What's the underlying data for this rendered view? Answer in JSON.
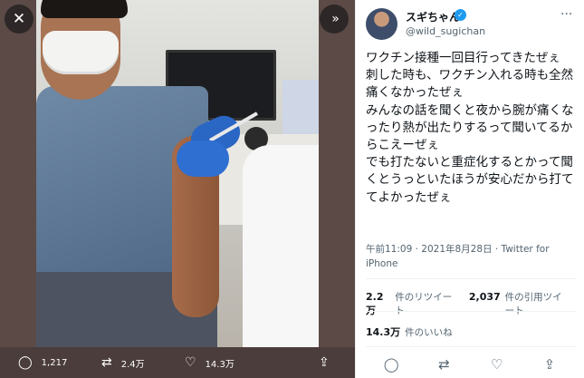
{
  "viewer": {
    "close_icon": "close-icon",
    "expand_icon": "expand-icon",
    "close_glyph": "✕",
    "expand_glyph": "»"
  },
  "media_actions": {
    "replies": "1,217",
    "retweets": "2.4万",
    "likes": "14.3万"
  },
  "tweet": {
    "display_name": "スギちゃん",
    "handle": "@wild_sugichan",
    "text": "ワクチン接種一回目行ってきたぜぇ\n刺した時も、ワクチン入れる時も全然痛くなかったぜぇ\nみんなの話を聞くと夜から腕が痛くなったり熱が出たりするって聞いてるからこえーぜぇ\nでも打たないと重症化するとかって聞くとうっといたほうが安心だから打ててよかったぜぇ",
    "timestamp": "午前11:09 · 2021年8月28日 · Twitter for iPhone",
    "retweet_count": "2.2万",
    "retweet_label": "件のリツイート",
    "quote_count": "2,037",
    "quote_label": "件の引用ツイート",
    "like_count": "14.3万",
    "like_label": "件のいいね"
  },
  "colors": {
    "accent": "#1d9bf0",
    "media_background": "#4a3d3b",
    "text_primary": "#0f1419",
    "text_secondary": "#536471"
  }
}
